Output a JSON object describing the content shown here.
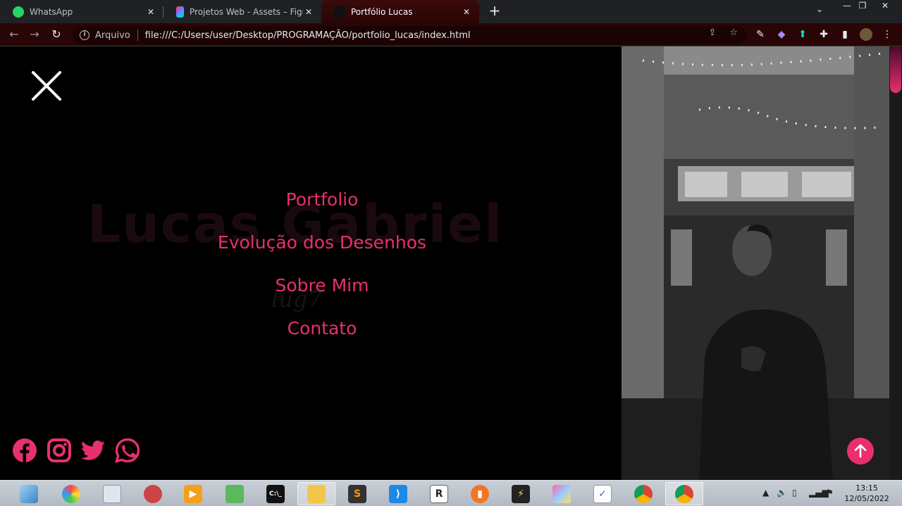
{
  "browser": {
    "tabs": [
      {
        "title": "WhatsApp",
        "close": "✕"
      },
      {
        "title": "Projetos Web - Assets – Figma",
        "close": "✕"
      },
      {
        "title": "Portfólio Lucas",
        "close": "✕"
      }
    ],
    "new_tab": "+",
    "url_scheme_label": "Arquivo",
    "url": "file:///C:/Users/user/Desktop/PROGRAMAÇÃO/portfolio_lucas/index.html",
    "accent_color": "#e8306f"
  },
  "page": {
    "ghost_title": "Lucas Gabriel",
    "ghost_logo": "lug7",
    "nav": {
      "items": [
        "Portfolio",
        "Evolução dos Desenhos",
        "Sobre Mim",
        "Contato"
      ]
    },
    "social_icons": [
      "facebook-icon",
      "instagram-icon",
      "twitter-icon",
      "whatsapp-icon"
    ]
  },
  "taskbar": {
    "time": "13:15",
    "date": "12/05/2022",
    "apps": [
      "explorer-icon",
      "paint-icon",
      "calculator-icon",
      "snipping-icon",
      "media-player-icon",
      "android-studio-icon",
      "terminal-icon",
      "file-explorer-icon",
      "sublime-icon",
      "vscode-icon",
      "rstudio-icon",
      "monitor-icon",
      "sketch-icon",
      "paint3d-icon",
      "todo-icon",
      "chrome-icon",
      "chrome-icon"
    ]
  }
}
